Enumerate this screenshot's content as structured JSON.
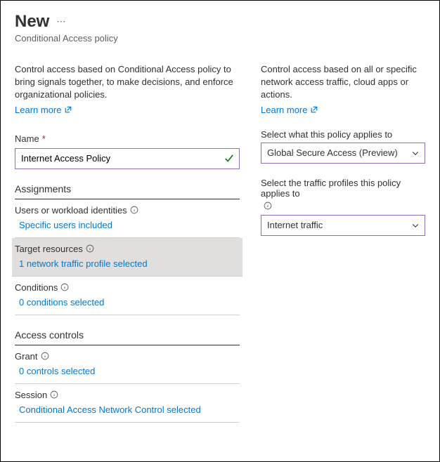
{
  "header": {
    "title": "New",
    "subtitle": "Conditional Access policy"
  },
  "left": {
    "intro": "Control access based on Conditional Access policy to bring signals together, to make decisions, and enforce organizational policies.",
    "learn_more": "Learn more",
    "name_label": "Name",
    "name_value": "Internet Access Policy",
    "assignments_header": "Assignments",
    "users_label": "Users or workload identities",
    "users_value": "Specific users included",
    "target_label": "Target resources",
    "target_value": "1 network traffic profile selected",
    "conditions_label": "Conditions",
    "conditions_value": "0 conditions selected",
    "access_header": "Access controls",
    "grant_label": "Grant",
    "grant_value": "0 controls selected",
    "session_label": "Session",
    "session_value": "Conditional Access Network Control selected"
  },
  "right": {
    "intro": "Control access based on all or specific network access traffic, cloud apps or actions.",
    "learn_more": "Learn more",
    "applies_label": "Select what this policy applies to",
    "applies_value": "Global Secure Access (Preview)",
    "traffic_label": "Select the traffic profiles this policy applies to",
    "traffic_value": "Internet traffic"
  }
}
